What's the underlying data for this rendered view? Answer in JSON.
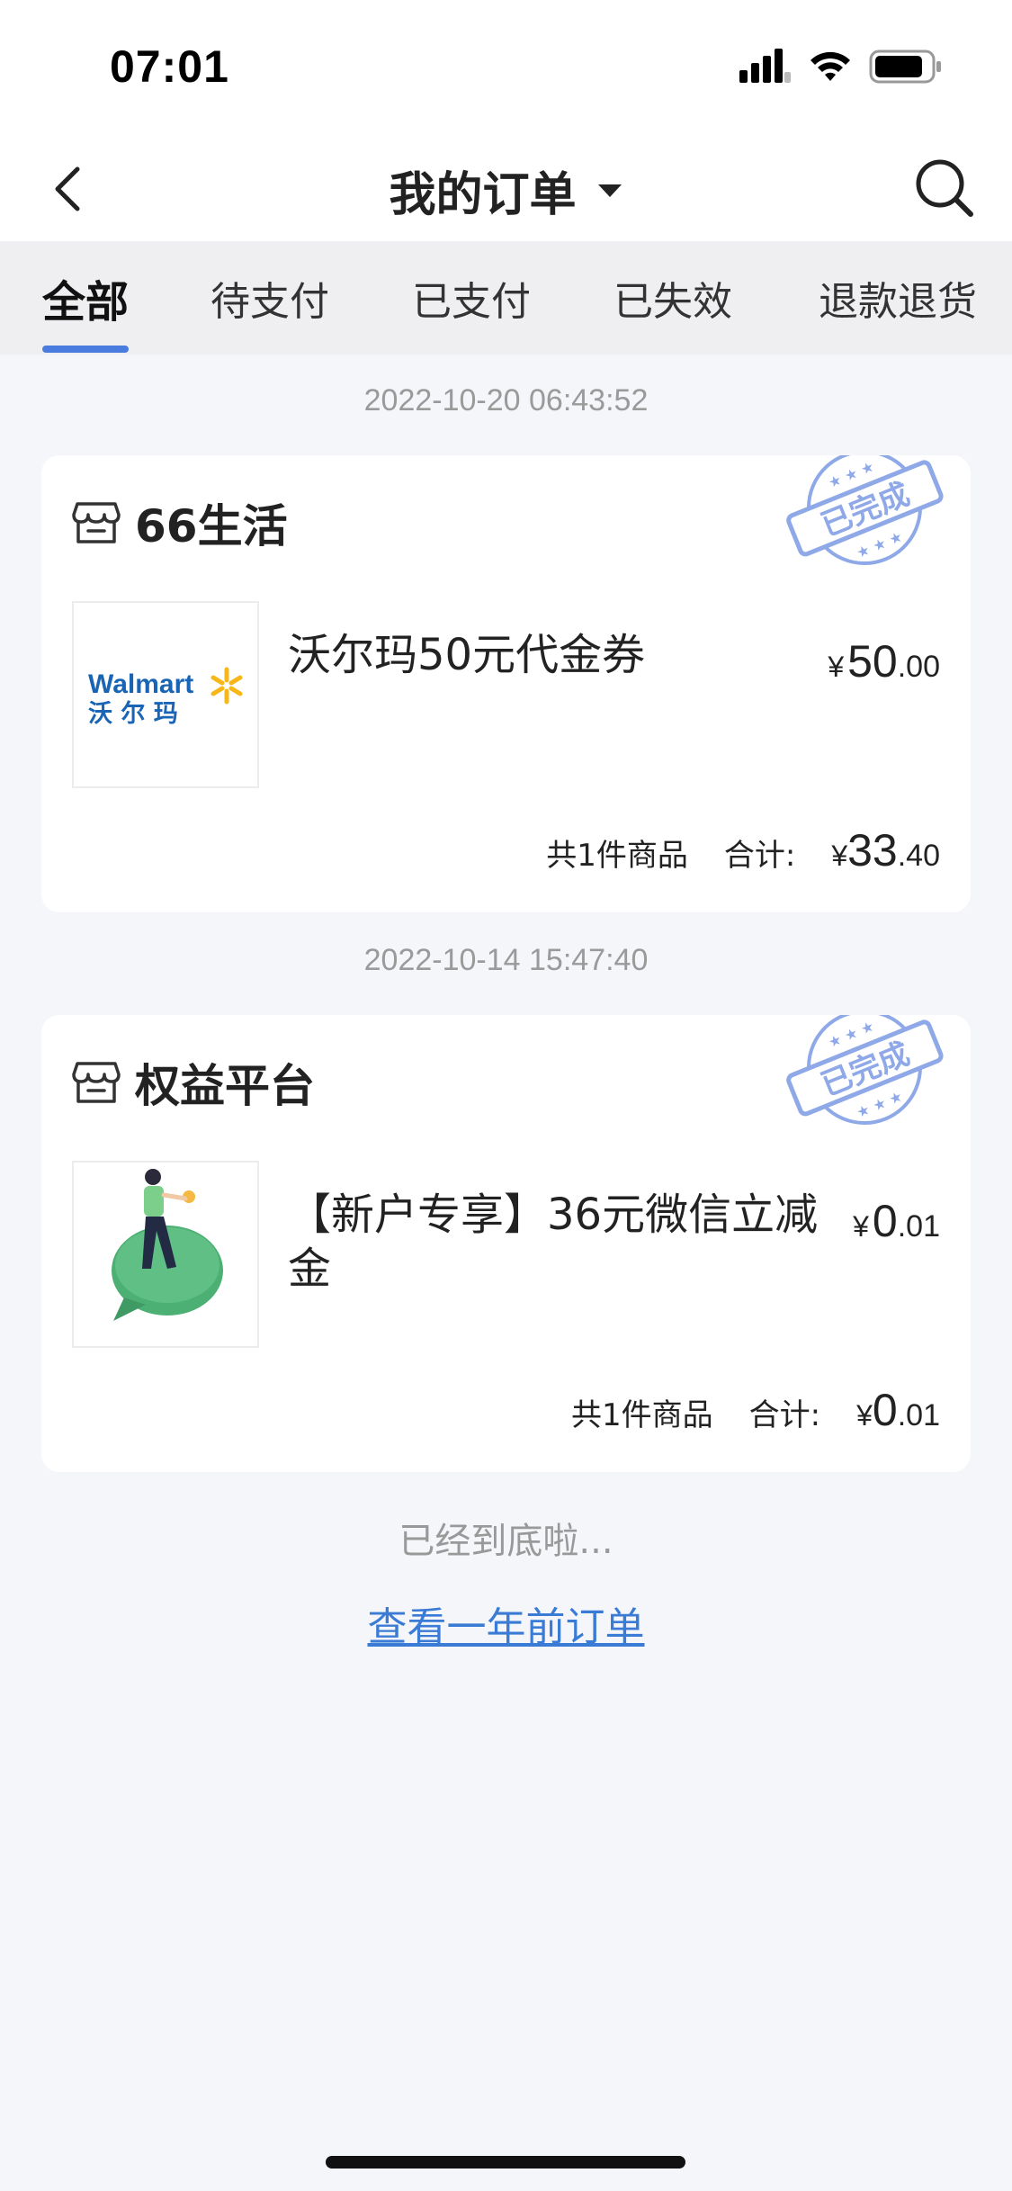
{
  "status_bar": {
    "time": "07:01",
    "icons": [
      "signal-icon",
      "wifi-icon",
      "battery-icon"
    ]
  },
  "header": {
    "title": "我的订单",
    "back_icon": "chevron-left-icon",
    "dropdown_icon": "caret-down-icon",
    "search_icon": "search-icon"
  },
  "tabs": [
    {
      "label": "全部",
      "active": true
    },
    {
      "label": "待支付",
      "active": false
    },
    {
      "label": "已支付",
      "active": false
    },
    {
      "label": "已失效",
      "active": false
    },
    {
      "label": "退款退货",
      "active": false
    }
  ],
  "accent_color": "#4a7ce0",
  "orders": [
    {
      "date": "2022-10-20 06:43:52",
      "store": "66生活",
      "status_stamp": "已完成",
      "product_logo_text": "Walmart",
      "product_logo_subtext": "沃 尔 玛",
      "product_name": "沃尔玛50元代金券",
      "price_currency": "¥",
      "price_int": "50",
      "price_dec": ".00",
      "item_count": "共1件商品",
      "total_label": "合计:",
      "total_currency": "¥",
      "total_int": "33",
      "total_dec": ".40"
    },
    {
      "date": "2022-10-14 15:47:40",
      "store": "权益平台",
      "status_stamp": "已完成",
      "product_name": "【新户专享】36元微信立减金",
      "price_currency": "¥",
      "price_int": "0",
      "price_dec": ".01",
      "item_count": "共1件商品",
      "total_label": "合计:",
      "total_currency": "¥",
      "total_int": "0",
      "total_dec": ".01"
    }
  ],
  "footer": {
    "end_note": "已经到底啦...",
    "history_link": "查看一年前订单"
  }
}
